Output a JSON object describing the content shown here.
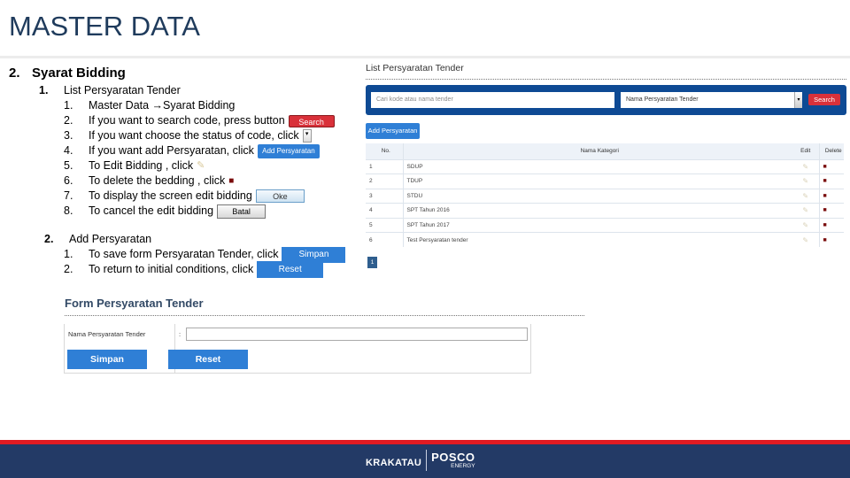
{
  "page_title": "MASTER DATA",
  "instructions": {
    "section": {
      "number": "2.",
      "title": "Syarat Bidding"
    },
    "subsections": [
      {
        "number": "1.",
        "title": "List Persyaratan Tender",
        "steps": [
          {
            "n": "1.",
            "text": "Master Data →Syarat Bidding"
          },
          {
            "n": "2.",
            "text": "If you want to search code, press button",
            "inline_button": "Search"
          },
          {
            "n": "3.",
            "text": "If you want choose the status of code, click",
            "inline_icon": "dropdown-arrow"
          },
          {
            "n": "4.",
            "text": "If you want add Persyaratan, click",
            "inline_button": "Add Persyaratan"
          },
          {
            "n": "5.",
            "text": "To Edit Bidding , click",
            "inline_icon": "edit-pencil"
          },
          {
            "n": "6.",
            "text": "To delete the bedding , click",
            "inline_icon": "trash"
          },
          {
            "n": "7.",
            "text": "To display the screen edit bidding",
            "inline_button": "Oke"
          },
          {
            "n": "8.",
            "text": "To cancel the edit bidding",
            "inline_button": "Batal"
          }
        ]
      },
      {
        "number": "2.",
        "title": "Add Persyaratan",
        "steps": [
          {
            "n": "1.",
            "text": "To save form Persyaratan Tender, click",
            "inline_button": "Simpan"
          },
          {
            "n": "2.",
            "text": "To return to initial conditions, click",
            "inline_button": "Reset"
          }
        ]
      }
    ]
  },
  "list_panel": {
    "title": "List Persyaratan Tender",
    "search_placeholder": "Cari kode atau nama tender",
    "select_value": "Nama Persyaratan Tender",
    "search_button": "Search",
    "add_button": "Add Persyaratan",
    "columns": [
      "No.",
      "Nama Kategori",
      "Edit",
      "Delete"
    ],
    "rows": [
      {
        "no": "1",
        "name": "SDUP"
      },
      {
        "no": "2",
        "name": "TDUP"
      },
      {
        "no": "3",
        "name": "STDU"
      },
      {
        "no": "4",
        "name": "SPT Tahun 2016"
      },
      {
        "no": "5",
        "name": "SPT Tahun 2017"
      },
      {
        "no": "6",
        "name": "Test Persyaratan tender"
      }
    ],
    "pagination": [
      "1"
    ]
  },
  "form_panel": {
    "title": "Form Persyaratan Tender",
    "field_label": "Nama Persyaratan Tender",
    "colon": ":",
    "field_value": "",
    "save_button": "Simpan",
    "reset_button": "Reset"
  },
  "footer": {
    "brand_left": "KRAKATAU",
    "brand_right": "POSCO",
    "brand_sub": "ENERGY"
  },
  "colors": {
    "title": "#1f3b5c",
    "search_bar": "#0e4a94",
    "primary_button": "#2f7fd6",
    "danger_button": "#d9313a",
    "footer_bg": "#233a66",
    "footer_stripe": "#e01b22"
  }
}
